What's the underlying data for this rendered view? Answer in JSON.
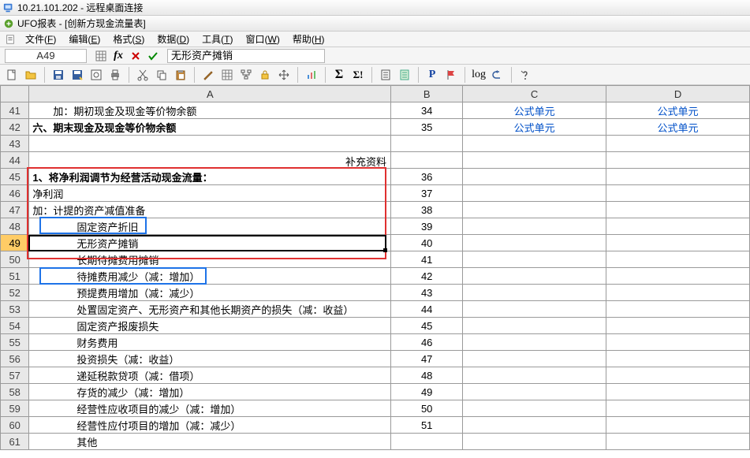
{
  "titlebar1": {
    "text": "10.21.101.202 - 远程桌面连接"
  },
  "titlebar2": {
    "text": "UFO报表 - [创新方现金流量表]"
  },
  "menu": {
    "file": {
      "label": "文件",
      "accel": "F"
    },
    "edit": {
      "label": "编辑",
      "accel": "E"
    },
    "format": {
      "label": "格式",
      "accel": "S"
    },
    "data": {
      "label": "数据",
      "accel": "D"
    },
    "tools": {
      "label": "工具",
      "accel": "T"
    },
    "window": {
      "label": "窗口",
      "accel": "W"
    },
    "help": {
      "label": "帮助",
      "accel": "H"
    }
  },
  "namebox": "A49",
  "formula": "无形资产摊销",
  "cols": {
    "A": "A",
    "B": "B",
    "C": "C",
    "D": "D"
  },
  "rows": [
    {
      "n": "41",
      "a_class": "indent1",
      "a": "加：期初现金及现金等价物余额",
      "b": "34",
      "c": "公式单元",
      "d": "公式单元"
    },
    {
      "n": "42",
      "a_class": "bold",
      "a": "六、期末现金及现金等价物余额",
      "b": "35",
      "c": "公式单元",
      "d": "公式单元"
    },
    {
      "n": "43",
      "a_class": "",
      "a": "",
      "b": "",
      "c": "",
      "d": ""
    },
    {
      "n": "44",
      "a_class": "",
      "a": "",
      "b": "补充资料",
      "c": "",
      "d": "",
      "b_align": "left-out"
    },
    {
      "n": "45",
      "a_class": "bold",
      "a": "1、将净利润调节为经营活动现金流量：",
      "b": "36",
      "c": "",
      "d": ""
    },
    {
      "n": "46",
      "a_class": "",
      "a": "净利润",
      "b": "37",
      "c": "",
      "d": ""
    },
    {
      "n": "47",
      "a_class": "",
      "a": "加：计提的资产减值准备",
      "b": "38",
      "c": "",
      "d": ""
    },
    {
      "n": "48",
      "a_class": "indent2",
      "a": "固定资产折旧",
      "b": "39",
      "c": "",
      "d": ""
    },
    {
      "n": "49",
      "a_class": "indent2",
      "a": "无形资产摊销",
      "b": "40",
      "c": "",
      "d": "",
      "sel": true
    },
    {
      "n": "50",
      "a_class": "indent2",
      "a": "长期待摊费用摊销",
      "b": "41",
      "c": "",
      "d": ""
    },
    {
      "n": "51",
      "a_class": "indent2",
      "a": "待摊费用减少（减：增加）",
      "b": "42",
      "c": "",
      "d": ""
    },
    {
      "n": "52",
      "a_class": "indent2",
      "a": "预提费用增加（减：减少）",
      "b": "43",
      "c": "",
      "d": ""
    },
    {
      "n": "53",
      "a_class": "indent2",
      "a": "处置固定资产、无形资产和其他长期资产的损失（减：收益）",
      "b": "44",
      "c": "",
      "d": ""
    },
    {
      "n": "54",
      "a_class": "indent2",
      "a": "固定资产报废损失",
      "b": "45",
      "c": "",
      "d": ""
    },
    {
      "n": "55",
      "a_class": "indent2",
      "a": "财务费用",
      "b": "46",
      "c": "",
      "d": ""
    },
    {
      "n": "56",
      "a_class": "indent2",
      "a": "投资损失（减：收益）",
      "b": "47",
      "c": "",
      "d": ""
    },
    {
      "n": "57",
      "a_class": "indent2",
      "a": "递延税款贷项（减：借项）",
      "b": "48",
      "c": "",
      "d": ""
    },
    {
      "n": "58",
      "a_class": "indent2",
      "a": "存货的减少（减：增加）",
      "b": "49",
      "c": "",
      "d": ""
    },
    {
      "n": "59",
      "a_class": "indent2",
      "a": "经营性应收项目的减少（减：增加）",
      "b": "50",
      "c": "",
      "d": ""
    },
    {
      "n": "60",
      "a_class": "indent2",
      "a": "经营性应付项目的增加（减：减少）",
      "b": "51",
      "c": "",
      "d": ""
    },
    {
      "n": "61",
      "a_class": "indent2",
      "a": "其他",
      "b": "",
      "c": "",
      "d": ""
    }
  ],
  "suppl_label": "补充资料"
}
